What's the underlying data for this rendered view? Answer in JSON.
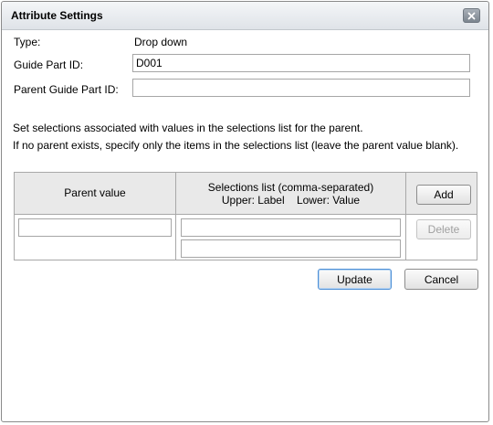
{
  "dialog": {
    "title": "Attribute Settings"
  },
  "form": {
    "type_label": "Type:",
    "type_value": "Drop down",
    "guide_part_id_label": "Guide Part ID:",
    "guide_part_id_value": "D001",
    "parent_guide_part_id_label": "Parent Guide Part ID:",
    "parent_guide_part_id_value": ""
  },
  "instructions": {
    "line1": "Set selections associated with values in the selections list for the parent.",
    "line2": "If no parent exists, specify only the items in the selections list (leave the parent value blank)."
  },
  "grid": {
    "header_parent_value": "Parent value",
    "header_selections_line1": "Selections list (comma-separated)",
    "header_selections_line2": "Upper: Label    Lower: Value",
    "add_label": "Add",
    "delete_label": "Delete",
    "row": {
      "parent_value": "",
      "selections_label": "",
      "selections_value": ""
    }
  },
  "footer": {
    "update_label": "Update",
    "cancel_label": "Cancel"
  }
}
